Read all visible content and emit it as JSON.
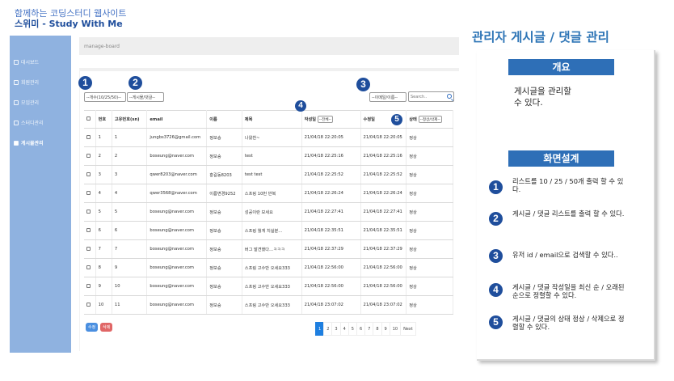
{
  "header": {
    "line1": "함께하는 코딩스터디 웹사이트",
    "line2": "스위미 - Study With Me"
  },
  "sidebar": {
    "items": [
      {
        "label": "대시보드"
      },
      {
        "label": "회원관리"
      },
      {
        "label": "모임관리"
      },
      {
        "label": "스터디관리"
      },
      {
        "label": "게시물관리",
        "active": true
      }
    ]
  },
  "breadcrumb": "manage-board",
  "filters": {
    "count": "--개수(10/25/50)--",
    "type": "--게시물/댓글--",
    "search_by": "--이메일/이름--",
    "search_placeholder": "Search.."
  },
  "table": {
    "headers": {
      "no": "번호",
      "uid": "고유번호(sn)",
      "email": "email",
      "name": "이름",
      "title": "제목",
      "created": "작성일",
      "created_sort": "--전체--",
      "updated": "수정일",
      "status": "상태",
      "status_sort": "--정상/삭제--"
    },
    "rows": [
      {
        "no": "1",
        "uid": "1",
        "email": "jungbs3726@gmail.com",
        "name": "정보승",
        "title": "나왔찬~",
        "created": "21/04/18 22:20:05",
        "updated": "21/04/18 22:20:05",
        "status": "정상"
      },
      {
        "no": "2",
        "uid": "2",
        "email": "boseung@naver.com",
        "name": "정보승",
        "title": "test",
        "created": "21/04/18 22:25:16",
        "updated": "21/04/18 22:25:16",
        "status": "정상"
      },
      {
        "no": "3",
        "uid": "3",
        "email": "qwer8203@naver.com",
        "name": "홍길동8203",
        "title": "test test",
        "created": "21/04/18 22:25:52",
        "updated": "21/04/18 22:25:52",
        "status": "정상"
      },
      {
        "no": "4",
        "uid": "4",
        "email": "qwer3568@naver.com",
        "name": "이름변경9252",
        "title": "스프링 10번 반복",
        "created": "21/04/18 22:26:24",
        "updated": "21/04/18 22:26:24",
        "status": "정상"
      },
      {
        "no": "5",
        "uid": "5",
        "email": "boseung@naver.com",
        "name": "정보승",
        "title": "성공이란 보세요",
        "created": "21/04/18 22:27:41",
        "updated": "21/04/18 22:27:41",
        "status": "정상"
      },
      {
        "no": "6",
        "uid": "6",
        "email": "boseung@naver.com",
        "name": "정보승",
        "title": "스프링 월게 치실분...",
        "created": "21/04/18 22:35:51",
        "updated": "21/04/18 22:35:51",
        "status": "정상"
      },
      {
        "no": "7",
        "uid": "7",
        "email": "boseung@naver.com",
        "name": "정보승",
        "title": "버그 발견했다...ㅋㅋㅋ",
        "created": "21/04/18 22:37:29",
        "updated": "21/04/18 22:37:29",
        "status": "정상"
      },
      {
        "no": "8",
        "uid": "9",
        "email": "boseung@naver.com",
        "name": "정보승",
        "title": "스프링 고수만 오세요333",
        "created": "21/04/18 22:56:00",
        "updated": "21/04/18 22:56:00",
        "status": "정상"
      },
      {
        "no": "9",
        "uid": "10",
        "email": "boseung@naver.com",
        "name": "정보승",
        "title": "스프링 고수만 오세요333",
        "created": "21/04/18 22:56:00",
        "updated": "21/04/18 22:56:00",
        "status": "정상"
      },
      {
        "no": "10",
        "uid": "11",
        "email": "boseung@naver.com",
        "name": "정보승",
        "title": "스프링 고수만 오세요333",
        "created": "21/04/18 23:07:02",
        "updated": "21/04/18 23:07:02",
        "status": "정상"
      }
    ]
  },
  "buttons": {
    "edit": "수정",
    "delete": "삭제"
  },
  "pagination": [
    "1",
    "2",
    "3",
    "4",
    "5",
    "6",
    "7",
    "8",
    "9",
    "10",
    "Next"
  ],
  "badges": [
    "1",
    "2",
    "3",
    "4",
    "5"
  ],
  "right": {
    "title": "관리자 게시글 / 댓글 관리",
    "overview_head": "개요",
    "overview_text1": "게시글을 관리할",
    "overview_text2": "수 있다.",
    "design_head": "화면설계",
    "items": [
      {
        "n": "1",
        "text": "리스트를 10 / 25 / 50개 출력 할 수 있다."
      },
      {
        "n": "2",
        "text": "게시글 / 댓글 리스트를 출력 할 수 있다."
      },
      {
        "n": "3",
        "text": "유저 id / email으로 검색할 수 있다.."
      },
      {
        "n": "4",
        "text": "게시글 / 댓글 작성일을 최신 순 / 오래된 순으로 정렬할 수 있다."
      },
      {
        "n": "5",
        "text": "게시글 / 댓글의 상태 정상 / 삭제으로 정렬할 수 있다."
      }
    ]
  },
  "colors": {
    "accent": "#1f4e9c",
    "sidebar": "#8fb2e0",
    "page_active": "#1e7fe0",
    "edit": "#4a8fe0",
    "delete": "#e06666"
  }
}
